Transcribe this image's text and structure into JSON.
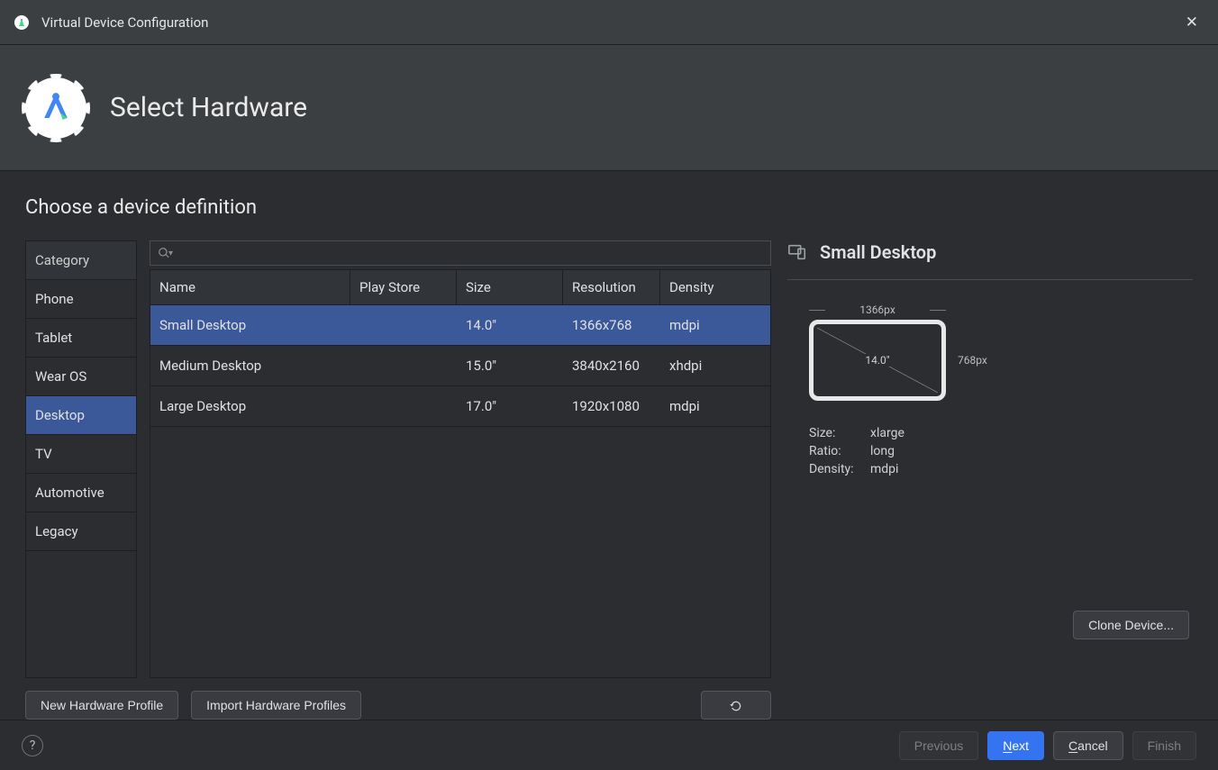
{
  "window": {
    "title": "Virtual Device Configuration"
  },
  "banner": {
    "title": "Select Hardware"
  },
  "section": {
    "title": "Choose a device definition"
  },
  "categories": {
    "header": "Category",
    "items": [
      "Phone",
      "Tablet",
      "Wear OS",
      "Desktop",
      "TV",
      "Automotive",
      "Legacy"
    ],
    "selected": "Desktop"
  },
  "search": {
    "placeholder": ""
  },
  "table": {
    "columns": {
      "name": "Name",
      "playstore": "Play Store",
      "size": "Size",
      "resolution": "Resolution",
      "density": "Density"
    },
    "rows": [
      {
        "name": "Small Desktop",
        "playstore": "",
        "size": "14.0\"",
        "resolution": "1366x768",
        "density": "mdpi",
        "selected": true
      },
      {
        "name": "Medium Desktop",
        "playstore": "",
        "size": "15.0\"",
        "resolution": "3840x2160",
        "density": "xhdpi",
        "selected": false
      },
      {
        "name": "Large Desktop",
        "playstore": "",
        "size": "17.0\"",
        "resolution": "1920x1080",
        "density": "mdpi",
        "selected": false
      }
    ]
  },
  "actions": {
    "new_profile": "New Hardware Profile",
    "import_profiles": "Import Hardware Profiles",
    "clone": "Clone Device...",
    "help": "?",
    "previous": "Previous",
    "next": "Next",
    "cancel": "Cancel",
    "finish": "Finish"
  },
  "detail": {
    "title": "Small Desktop",
    "width_label": "1366px",
    "height_label": "768px",
    "diag_label": "14.0\"",
    "specs": {
      "size_label": "Size:",
      "size_value": "xlarge",
      "ratio_label": "Ratio:",
      "ratio_value": "long",
      "density_label": "Density:",
      "density_value": "mdpi"
    }
  }
}
